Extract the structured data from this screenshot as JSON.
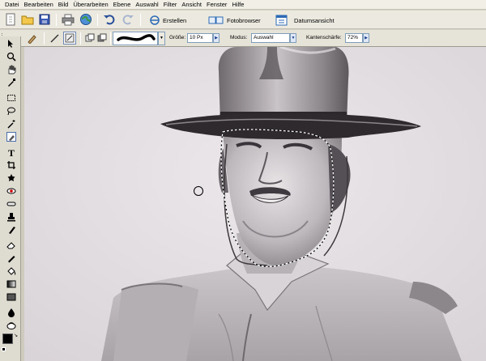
{
  "menu": [
    "Datei",
    "Bearbeiten",
    "Bild",
    "Überarbeiten",
    "Ebene",
    "Auswahl",
    "Filter",
    "Ansicht",
    "Fenster",
    "Hilfe"
  ],
  "toolbar": {
    "create_label": "Erstellen",
    "photobrowser_label": "Fotobrowser",
    "dateview_label": "Datumsansicht"
  },
  "options": {
    "size_label": "Größe:",
    "size_value": "10 Px",
    "mode_label": "Modus:",
    "mode_value": "Auswahl",
    "sharpness_label": "Kantenschärfe:",
    "sharpness_value": "72%"
  },
  "icons": {
    "new": "new-document-icon",
    "open": "open-folder-icon",
    "save": "save-icon",
    "print": "print-icon",
    "web": "globe-icon",
    "undo": "undo-icon",
    "redo": "redo-icon"
  },
  "colors": {
    "toolbar_bg": "#eceae0",
    "selection_marquee": "#ffffff",
    "foreground": "#000000",
    "background": "#ffffff"
  },
  "tools": [
    "move-tool",
    "zoom-tool",
    "hand-tool",
    "eyedropper-tool",
    "marquee-tool",
    "lasso-tool",
    "magic-wand-tool",
    "selection-brush-tool",
    "type-tool",
    "crop-tool",
    "cookie-cutter-tool",
    "red-eye-tool",
    "healing-brush-tool",
    "clone-stamp-tool",
    "eraser-tool",
    "pencil-tool",
    "paint-bucket-tool",
    "gradient-tool",
    "shape-tool",
    "blur-tool",
    "sponge-tool"
  ]
}
